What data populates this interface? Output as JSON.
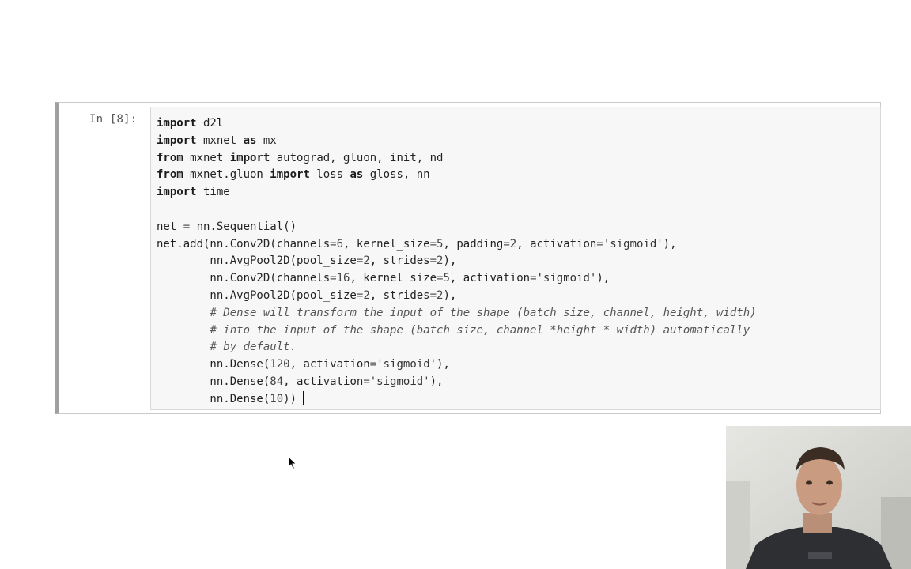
{
  "cell": {
    "prompt": "In [8]:",
    "lines": [
      [
        {
          "t": "kw",
          "v": "import"
        },
        {
          "t": "p",
          "v": " d2l"
        }
      ],
      [
        {
          "t": "kw",
          "v": "import"
        },
        {
          "t": "p",
          "v": " mxnet "
        },
        {
          "t": "kw",
          "v": "as"
        },
        {
          "t": "p",
          "v": " mx"
        }
      ],
      [
        {
          "t": "kw",
          "v": "from"
        },
        {
          "t": "p",
          "v": " mxnet "
        },
        {
          "t": "kw",
          "v": "import"
        },
        {
          "t": "p",
          "v": " autograd, gluon, init, nd"
        }
      ],
      [
        {
          "t": "kw",
          "v": "from"
        },
        {
          "t": "p",
          "v": " mxnet.gluon "
        },
        {
          "t": "kw",
          "v": "import"
        },
        {
          "t": "p",
          "v": " loss "
        },
        {
          "t": "kw",
          "v": "as"
        },
        {
          "t": "p",
          "v": " gloss, nn"
        }
      ],
      [
        {
          "t": "kw",
          "v": "import"
        },
        {
          "t": "p",
          "v": " time"
        }
      ],
      [],
      [
        {
          "t": "p",
          "v": "net "
        },
        {
          "t": "op",
          "v": "="
        },
        {
          "t": "p",
          "v": " nn.Sequential()"
        }
      ],
      [
        {
          "t": "p",
          "v": "net.add(nn.Conv2D(channels"
        },
        {
          "t": "op",
          "v": "="
        },
        {
          "t": "num",
          "v": "6"
        },
        {
          "t": "p",
          "v": ", kernel_size"
        },
        {
          "t": "op",
          "v": "="
        },
        {
          "t": "num",
          "v": "5"
        },
        {
          "t": "p",
          "v": ", padding"
        },
        {
          "t": "op",
          "v": "="
        },
        {
          "t": "num",
          "v": "2"
        },
        {
          "t": "p",
          "v": ", activation"
        },
        {
          "t": "op",
          "v": "="
        },
        {
          "t": "str",
          "v": "'sigmoid'"
        },
        {
          "t": "p",
          "v": "),"
        }
      ],
      [
        {
          "t": "p",
          "v": "        nn.AvgPool2D(pool_size"
        },
        {
          "t": "op",
          "v": "="
        },
        {
          "t": "num",
          "v": "2"
        },
        {
          "t": "p",
          "v": ", strides"
        },
        {
          "t": "op",
          "v": "="
        },
        {
          "t": "num",
          "v": "2"
        },
        {
          "t": "p",
          "v": "),"
        }
      ],
      [
        {
          "t": "p",
          "v": "        nn.Conv2D(channels"
        },
        {
          "t": "op",
          "v": "="
        },
        {
          "t": "num",
          "v": "16"
        },
        {
          "t": "p",
          "v": ", kernel_size"
        },
        {
          "t": "op",
          "v": "="
        },
        {
          "t": "num",
          "v": "5"
        },
        {
          "t": "p",
          "v": ", activation"
        },
        {
          "t": "op",
          "v": "="
        },
        {
          "t": "str",
          "v": "'sigmoid'"
        },
        {
          "t": "p",
          "v": "),"
        }
      ],
      [
        {
          "t": "p",
          "v": "        nn.AvgPool2D(pool_size"
        },
        {
          "t": "op",
          "v": "="
        },
        {
          "t": "num",
          "v": "2"
        },
        {
          "t": "p",
          "v": ", strides"
        },
        {
          "t": "op",
          "v": "="
        },
        {
          "t": "num",
          "v": "2"
        },
        {
          "t": "p",
          "v": "),"
        }
      ],
      [
        {
          "t": "p",
          "v": "        "
        },
        {
          "t": "cm",
          "v": "# Dense will transform the input of the shape (batch size, channel, height, width)"
        }
      ],
      [
        {
          "t": "p",
          "v": "        "
        },
        {
          "t": "cm",
          "v": "# into the input of the shape (batch size, channel *height * width) automatically"
        }
      ],
      [
        {
          "t": "p",
          "v": "        "
        },
        {
          "t": "cm",
          "v": "# by default."
        }
      ],
      [
        {
          "t": "p",
          "v": "        nn.Dense("
        },
        {
          "t": "num",
          "v": "120"
        },
        {
          "t": "p",
          "v": ", activation"
        },
        {
          "t": "op",
          "v": "="
        },
        {
          "t": "str",
          "v": "'sigmoid'"
        },
        {
          "t": "p",
          "v": "),"
        }
      ],
      [
        {
          "t": "p",
          "v": "        nn.Dense("
        },
        {
          "t": "num",
          "v": "84"
        },
        {
          "t": "p",
          "v": ", activation"
        },
        {
          "t": "op",
          "v": "="
        },
        {
          "t": "str",
          "v": "'sigmoid'"
        },
        {
          "t": "p",
          "v": "),"
        }
      ],
      [
        {
          "t": "p",
          "v": "        nn.Dense("
        },
        {
          "t": "num",
          "v": "10"
        },
        {
          "t": "p",
          "v": "))"
        }
      ]
    ]
  },
  "colors": {
    "cell_border": "#c9c9c9",
    "cell_left_bar": "#a0a0a0",
    "editor_bg": "#f7f7f7"
  },
  "icons": {
    "mouse_pointer": "mouse-pointer-icon"
  }
}
